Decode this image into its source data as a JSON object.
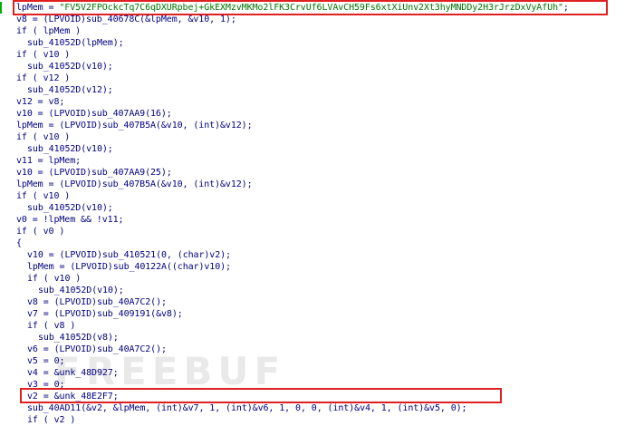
{
  "lines": [
    {
      "indent": 0,
      "text": "lpMem = \"FV5V2FPOckcTq7C6qDXURpbej+GkEXMzvMKMo2lFK3CrvUf6LVAvCH59Fs6xtXiUnv2Xt3hyMNDDy2H3rJrzDxVyAfUh\";"
    },
    {
      "indent": 0,
      "text": "v8 = (LPVOID)sub_40678C(&lpMem, &v10, 1);"
    },
    {
      "indent": 0,
      "text": "if ( lpMem )"
    },
    {
      "indent": 1,
      "text": "sub_41052D(lpMem);"
    },
    {
      "indent": 0,
      "text": "if ( v10 )"
    },
    {
      "indent": 1,
      "text": "sub_41052D(v10);"
    },
    {
      "indent": 0,
      "text": "if ( v12 )"
    },
    {
      "indent": 1,
      "text": "sub_41052D(v12);"
    },
    {
      "indent": 0,
      "text": "v12 = v8;"
    },
    {
      "indent": 0,
      "text": "v10 = (LPVOID)sub_407AA9(16);"
    },
    {
      "indent": 0,
      "text": "lpMem = (LPVOID)sub_407B5A(&v10, (int)&v12);"
    },
    {
      "indent": 0,
      "text": "if ( v10 )"
    },
    {
      "indent": 1,
      "text": "sub_41052D(v10);"
    },
    {
      "indent": 0,
      "text": "v11 = lpMem;"
    },
    {
      "indent": 0,
      "text": "v10 = (LPVOID)sub_407AA9(25);"
    },
    {
      "indent": 0,
      "text": "lpMem = (LPVOID)sub_407B5A(&v10, (int)&v12);"
    },
    {
      "indent": 0,
      "text": "if ( v10 )"
    },
    {
      "indent": 1,
      "text": "sub_41052D(v10);"
    },
    {
      "indent": 0,
      "text": "v0 = !lpMem && !v11;"
    },
    {
      "indent": 0,
      "text": "if ( v0 )"
    },
    {
      "indent": 0,
      "text": "{"
    },
    {
      "indent": 1,
      "text": "v10 = (LPVOID)sub_410521(0, (char)v2);"
    },
    {
      "indent": 1,
      "text": "lpMem = (LPVOID)sub_40122A((char)v10);"
    },
    {
      "indent": 1,
      "text": "if ( v10 )"
    },
    {
      "indent": 2,
      "text": "sub_41052D(v10);"
    },
    {
      "indent": 1,
      "text": "v8 = (LPVOID)sub_40A7C2();"
    },
    {
      "indent": 1,
      "text": "v7 = (LPVOID)sub_409191(&v8);"
    },
    {
      "indent": 1,
      "text": "if ( v8 )"
    },
    {
      "indent": 2,
      "text": "sub_41052D(v8);"
    },
    {
      "indent": 1,
      "text": "v6 = (LPVOID)sub_40A7C2();"
    },
    {
      "indent": 1,
      "text": "v5 = 0;"
    },
    {
      "indent": 1,
      "text": "v4 = &unk_48D927;"
    },
    {
      "indent": 1,
      "text": "v3 = 0;"
    },
    {
      "indent": 1,
      "text": "v2 = &unk_48E2F7;"
    },
    {
      "indent": 1,
      "text": "sub_40AD11(&v2, &lpMem, (int)&v7, 1, (int)&v6, 1, 0, 0, (int)&v4, 1, (int)&v5, 0);"
    },
    {
      "indent": 1,
      "text": "if ( v2 )"
    }
  ],
  "watermark": "FREEBUF",
  "colors": {
    "highlight_box": "#e02020",
    "string": "#007700",
    "code": "#000080"
  }
}
